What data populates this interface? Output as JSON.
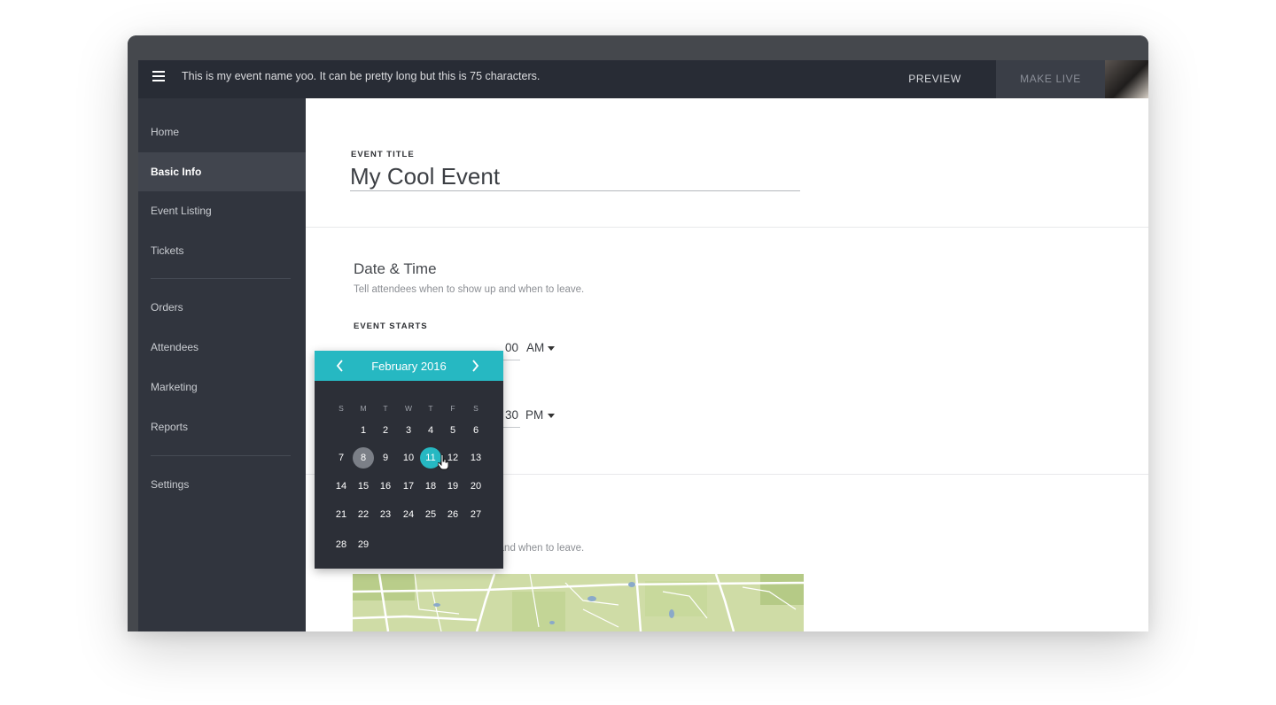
{
  "topbar": {
    "event_name": "This is my event name yoo. It can be pretty long but this is 75 characters.",
    "preview_label": "PREVIEW",
    "make_live_label": "MAKE LIVE"
  },
  "sidebar": {
    "items": [
      {
        "label": "Home"
      },
      {
        "label": "Basic Info",
        "active": true
      },
      {
        "label": "Event Listing"
      },
      {
        "label": "Tickets"
      },
      {
        "label": "Orders"
      },
      {
        "label": "Attendees"
      },
      {
        "label": "Marketing"
      },
      {
        "label": "Reports"
      },
      {
        "label": "Settings"
      }
    ]
  },
  "main": {
    "event_title": {
      "label": "EVENT TITLE",
      "value": "My Cool Event"
    },
    "date_time": {
      "title": "Date & Time",
      "description": "Tell attendees when to show up and when to leave.",
      "starts_label": "EVENT STARTS",
      "start_time": "00",
      "start_meridiem": "AM",
      "end_time": "30",
      "end_meridiem": "PM"
    },
    "location": {
      "description": "Tell attendees when to show up and when to leave."
    }
  },
  "calendar": {
    "month_label": "February 2016",
    "weekdays": [
      "S",
      "M",
      "T",
      "W",
      "T",
      "F",
      "S"
    ],
    "today": 8,
    "selected": 11,
    "weeks": [
      [
        "",
        "1",
        "2",
        "3",
        "4",
        "5",
        "6"
      ],
      [
        "7",
        "8",
        "9",
        "10",
        "11",
        "12",
        "13"
      ],
      [
        "14",
        "15",
        "16",
        "17",
        "18",
        "19",
        "20"
      ],
      [
        "21",
        "22",
        "23",
        "24",
        "25",
        "26",
        "27"
      ],
      [
        "28",
        "29",
        "",
        "",
        "",
        "",
        ""
      ]
    ]
  },
  "colors": {
    "accent": "#26b8c2",
    "sidebar": "#31353e",
    "topbar": "#282c35"
  }
}
